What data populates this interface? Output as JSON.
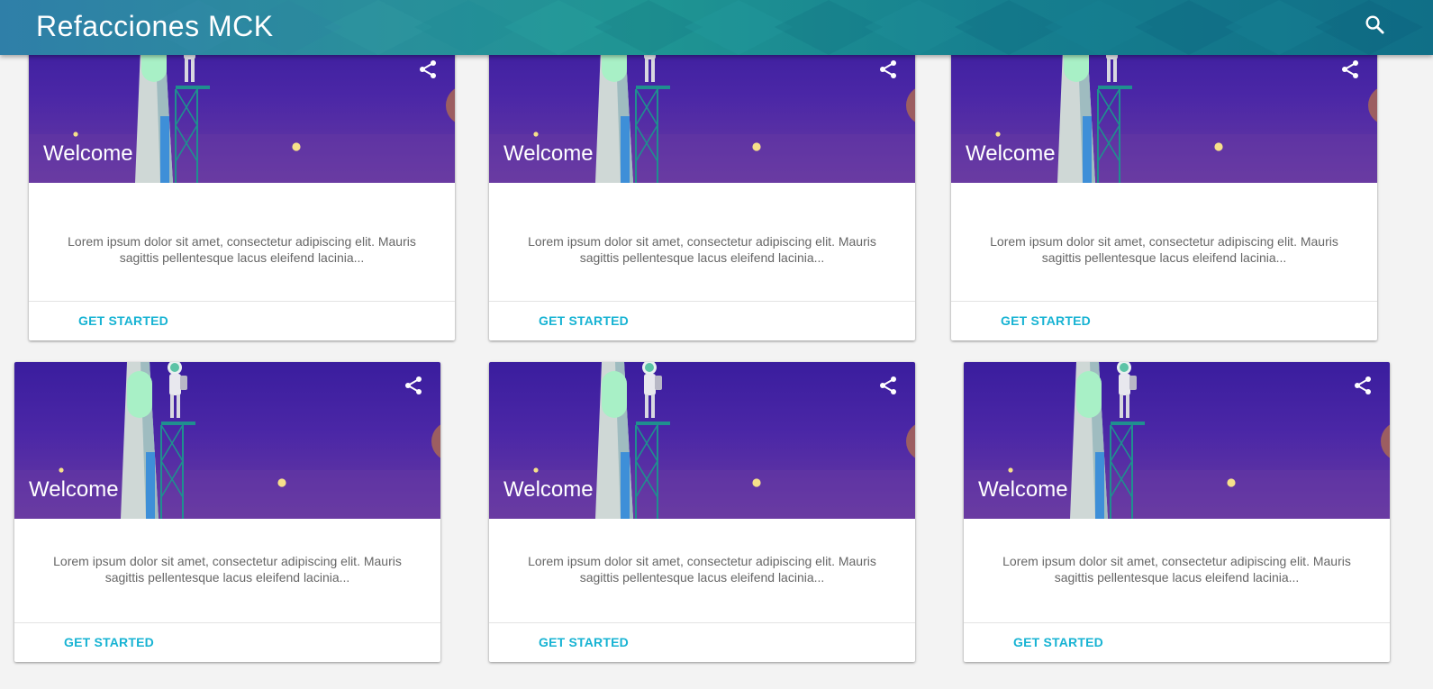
{
  "header": {
    "title": "Refacciones MCK",
    "search_icon": "search-icon"
  },
  "colors": {
    "header_start": "#2f7fa8",
    "header_end": "#106f87",
    "card_media_top": "#3a1d9e",
    "card_media_bottom": "#6a3ba2",
    "action_text": "#17b3d3",
    "body_text": "#666666",
    "background": "#f3f3f3"
  },
  "cards": [
    {
      "title": "Welcome",
      "text": "Lorem ipsum dolor sit amet, consectetur adipiscing elit. Mauris sagittis pellentesque lacus eleifend lacinia...",
      "action": "GET STARTED",
      "share_icon": "share-icon"
    },
    {
      "title": "Welcome",
      "text": "Lorem ipsum dolor sit amet, consectetur adipiscing elit. Mauris sagittis pellentesque lacus eleifend lacinia...",
      "action": "GET STARTED",
      "share_icon": "share-icon"
    },
    {
      "title": "Welcome",
      "text": "Lorem ipsum dolor sit amet, consectetur adipiscing elit. Mauris sagittis pellentesque lacus eleifend lacinia...",
      "action": "GET STARTED",
      "share_icon": "share-icon"
    },
    {
      "title": "Welcome",
      "text": "Lorem ipsum dolor sit amet, consectetur adipiscing elit. Mauris sagittis pellentesque lacus eleifend lacinia...",
      "action": "GET STARTED",
      "share_icon": "share-icon"
    },
    {
      "title": "Welcome",
      "text": "Lorem ipsum dolor sit amet, consectetur adipiscing elit. Mauris sagittis pellentesque lacus eleifend lacinia...",
      "action": "GET STARTED",
      "share_icon": "share-icon"
    },
    {
      "title": "Welcome",
      "text": "Lorem ipsum dolor sit amet, consectetur adipiscing elit. Mauris sagittis pellentesque lacus eleifend lacinia...",
      "action": "GET STARTED",
      "share_icon": "share-icon"
    }
  ]
}
